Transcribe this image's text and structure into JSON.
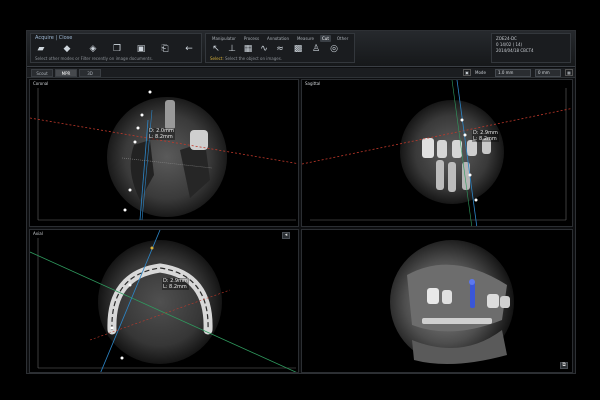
{
  "toolbar": {
    "acquire_title": "Acquire | Close",
    "acquire_status": "Select other modes or Filter recently on image documents.",
    "tabs": [
      "Manipulator",
      "Process",
      "Annotation",
      "Measure",
      "Cut",
      "Other"
    ],
    "process_status": "Select the object on images."
  },
  "patient_info": {
    "line1": "ZOE24-DC",
    "line2": "0 14/02    (  14)",
    "line3": "2014/04/18   CBCT4"
  },
  "view_tabs": [
    "Scout",
    "MPR",
    "3D"
  ],
  "view_controls": {
    "mode_label": "Mode",
    "slice_value": "1.0 mm",
    "thickness_value": "0 mm"
  },
  "viewports": {
    "coronal": {
      "title": "Coronal",
      "measure": [
        "D: 2.0mm",
        "L: 8.2mm"
      ]
    },
    "sagittal": {
      "title": "Sagittal",
      "measure": [
        "D: 2.9mm",
        "L: 8.2mm"
      ]
    },
    "axial": {
      "title": "Axial",
      "measure": [
        "D: 2.9mm",
        "L: 8.2mm"
      ]
    },
    "volume": {
      "title": ""
    }
  },
  "colors": {
    "accent": "#d7b03a",
    "cut_line": "#c0392b",
    "guide_cyan": "#2c86c8",
    "guide_green": "#2f9a5e"
  }
}
